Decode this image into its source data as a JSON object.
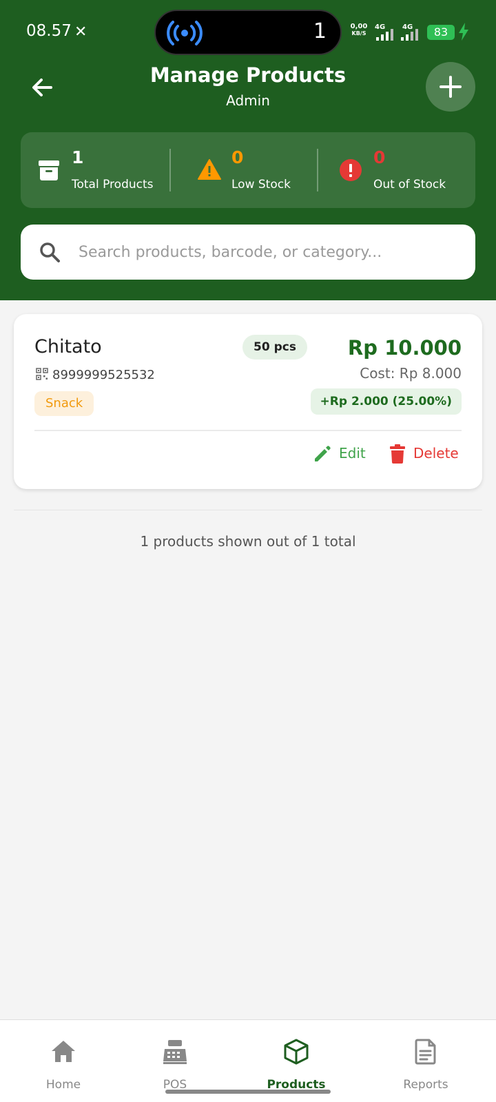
{
  "status_bar": {
    "time": "08.57",
    "island_count": "1",
    "net_speed_value": "0,00",
    "net_speed_unit": "KB/S",
    "net1": "4G",
    "net2": "4G",
    "battery": "83"
  },
  "header": {
    "title": "Manage Products",
    "subtitle": "Admin"
  },
  "stats": [
    {
      "value": "1",
      "label": "Total Products",
      "color": "#ffffff"
    },
    {
      "value": "0",
      "label": "Low Stock",
      "color": "#ff9800"
    },
    {
      "value": "0",
      "label": "Out of Stock",
      "color": "#e53935"
    }
  ],
  "search": {
    "placeholder": "Search products, barcode, or category...",
    "value": ""
  },
  "products": [
    {
      "name": "Chitato",
      "stock": "50 pcs",
      "barcode": "8999999525532",
      "category": "Snack",
      "price": "Rp 10.000",
      "cost": "Cost: Rp 8.000",
      "margin": "+Rp 2.000 (25.00%)",
      "edit_label": "Edit",
      "delete_label": "Delete"
    }
  ],
  "list_footer": "1 products shown out of 1 total",
  "nav": [
    {
      "label": "Home",
      "icon": "home-icon"
    },
    {
      "label": "POS",
      "icon": "cash-register-icon"
    },
    {
      "label": "Products",
      "icon": "cube-icon",
      "active": true
    },
    {
      "label": "Reports",
      "icon": "report-icon"
    }
  ],
  "colors": {
    "primary": "#1e5e20",
    "accent_green": "#1e6b1f",
    "warning": "#ff9800",
    "danger": "#e53935",
    "category_text": "#f19a0e"
  }
}
